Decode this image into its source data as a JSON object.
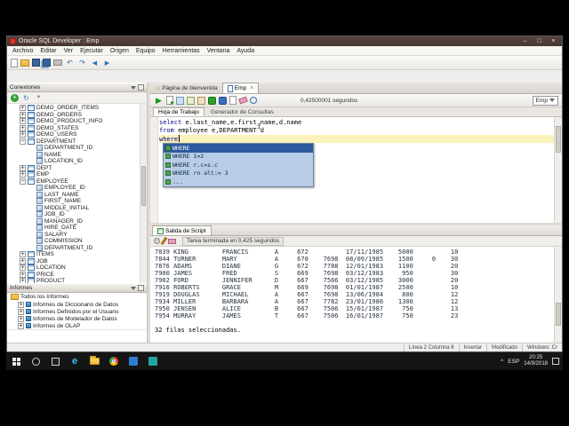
{
  "window": {
    "title": "Oracle SQL Developer : Emp",
    "controls": {
      "minimize": "–",
      "maximize": "□",
      "close": "×"
    }
  },
  "menu": {
    "items": [
      "Archivo",
      "Editar",
      "Ver",
      "Ejecutar",
      "Origen",
      "Equipo",
      "Herramientas",
      "Ventana",
      "Ayuda"
    ]
  },
  "main_toolbar": {
    "icons": [
      "new-file",
      "open-folder",
      "save",
      "save-all",
      "print",
      "undo",
      "redo",
      "back",
      "forward"
    ]
  },
  "connections": {
    "title": "Conexiones",
    "toolbar_icons": [
      "new-connection",
      "refresh",
      "apply-filter"
    ],
    "tree": [
      {
        "label": "DEMO_ORDER_ITEMS",
        "level": 1,
        "icon": "table",
        "expand": "plus"
      },
      {
        "label": "DEMO_ORDERS",
        "level": 1,
        "icon": "table",
        "expand": "plus"
      },
      {
        "label": "DEMO_PRODUCT_INFO",
        "level": 1,
        "icon": "table",
        "expand": "plus"
      },
      {
        "label": "DEMO_STATES",
        "level": 1,
        "icon": "table",
        "expand": "plus"
      },
      {
        "label": "DEMO_USERS",
        "level": 1,
        "icon": "table",
        "expand": "plus"
      },
      {
        "label": "DEPARTMENT",
        "level": 1,
        "icon": "table",
        "expand": "minus"
      },
      {
        "label": "DEPARTMENT_ID",
        "level": 2,
        "icon": "column"
      },
      {
        "label": "NAME",
        "level": 2,
        "icon": "column"
      },
      {
        "label": "LOCATION_ID",
        "level": 2,
        "icon": "column"
      },
      {
        "label": "DEPT",
        "level": 1,
        "icon": "table",
        "expand": "plus"
      },
      {
        "label": "EMP",
        "level": 1,
        "icon": "table",
        "expand": "plus"
      },
      {
        "label": "EMPLOYEE",
        "level": 1,
        "icon": "table",
        "expand": "minus"
      },
      {
        "label": "EMPLOYEE_ID",
        "level": 2,
        "icon": "column"
      },
      {
        "label": "LAST_NAME",
        "level": 2,
        "icon": "column"
      },
      {
        "label": "FIRST_NAME",
        "level": 2,
        "icon": "column"
      },
      {
        "label": "MIDDLE_INITIAL",
        "level": 2,
        "icon": "column"
      },
      {
        "label": "JOB_ID",
        "level": 2,
        "icon": "column"
      },
      {
        "label": "MANAGER_ID",
        "level": 2,
        "icon": "column"
      },
      {
        "label": "HIRE_DATE",
        "level": 2,
        "icon": "column"
      },
      {
        "label": "SALARY",
        "level": 2,
        "icon": "column"
      },
      {
        "label": "COMMISSION",
        "level": 2,
        "icon": "column"
      },
      {
        "label": "DEPARTMENT_ID",
        "level": 2,
        "icon": "column"
      },
      {
        "label": "ITEMS",
        "level": 1,
        "icon": "table",
        "expand": "plus"
      },
      {
        "label": "JOB",
        "level": 1,
        "icon": "table",
        "expand": "plus"
      },
      {
        "label": "LOCATION",
        "level": 1,
        "icon": "table",
        "expand": "plus"
      },
      {
        "label": "PRICE",
        "level": 1,
        "icon": "table",
        "expand": "plus"
      },
      {
        "label": "PRODUCT",
        "level": 1,
        "icon": "table",
        "expand": "plus"
      }
    ]
  },
  "reports": {
    "title": "Informes",
    "root": "Todos los Informes",
    "items": [
      "Informes de Diccionario de Datos",
      "Informes Definidos por el Usuario",
      "Informes de Modelador de Datos",
      "Informes de OLAP"
    ]
  },
  "doc_tabs": {
    "tabs": [
      {
        "label": "Página de bienvenida",
        "active": false
      },
      {
        "label": "Emp",
        "active": true
      }
    ]
  },
  "worksheet": {
    "toolbar_icons": [
      "run-statement",
      "run-script",
      "autotrace",
      "explain-plan",
      "sql-tuning",
      "commit",
      "rollback",
      "unshared-worksheet",
      "clear",
      "history"
    ],
    "timer": "0,42500001 segundos",
    "connection_selector": "Emp",
    "tabs": [
      {
        "label": "Hoja de Trabajo",
        "active": true
      },
      {
        "label": "Generador de Consultas",
        "active": false
      }
    ],
    "sql_lines": [
      {
        "tokens": [
          {
            "t": "kw",
            "s": "select"
          },
          {
            "t": "tx",
            "s": " e.last_name,e.first_name,d.name"
          }
        ]
      },
      {
        "tokens": [
          {
            "t": "kw",
            "s": "from"
          },
          {
            "t": "tx",
            "s": " employee e,DEPARTMENT d"
          }
        ]
      },
      {
        "tokens": [
          {
            "t": "kw",
            "s": "where"
          }
        ],
        "current": true
      }
    ],
    "autocomplete": [
      {
        "label": "WHERE",
        "selected": true
      },
      {
        "label": "WHERE 1=2"
      },
      {
        "label": "WHERE r.c=s.c"
      },
      {
        "label": "WHERE rn alt:= 3"
      },
      {
        "label": "..."
      }
    ]
  },
  "script_output": {
    "tab_label": "Salida de Script",
    "toolbar_icons": [
      "pin",
      "edit",
      "clear-output"
    ],
    "status": "Tarea terminada en 0,425 segundos",
    "rows": [
      "7839 KING         FRANCIS       A     672          17/11/1985    5000          10",
      "7844 TURNER       MARY          A     670    7698  08/09/1985    1500     0    30",
      "7876 ADAMS        DIANE         G     672    7788  12/01/1983    1100          20",
      "7900 JAMES        FRED          S     669    7698  03/12/1983     950          30",
      "7902 FORD         JENNIFER      D     667    7566  03/12/1985    3000          20",
      "7916 ROBERTS      GRACE         M     669    7698  01/01/1987    2500          10",
      "7919 DOUGLAS      MICHAEL       A     667    7698  13/06/1984     800          12",
      "7934 MILLER       BARBARA       A     667    7782  23/01/1986    1300          12",
      "7950 JENSEN       ALICE         B     667    7506  15/01/1987     750          13",
      "7954 MURRAY       JAMES         T     667    7506  16/01/1987     750          23"
    ],
    "footer": "32 filas seleccionadas."
  },
  "status_bar": {
    "segments": [
      "Línea 2 Columna 6",
      "Insertar",
      "Modificado",
      "Windows: Cr"
    ]
  },
  "taskbar": {
    "apps": [
      "start",
      "search",
      "task-view",
      "edge",
      "file-explorer",
      "chrome",
      "app-blue",
      "app-teal"
    ],
    "tray": {
      "expand": "^",
      "lang": "ESP",
      "time": "20:25",
      "date": "14/9/2018"
    }
  }
}
